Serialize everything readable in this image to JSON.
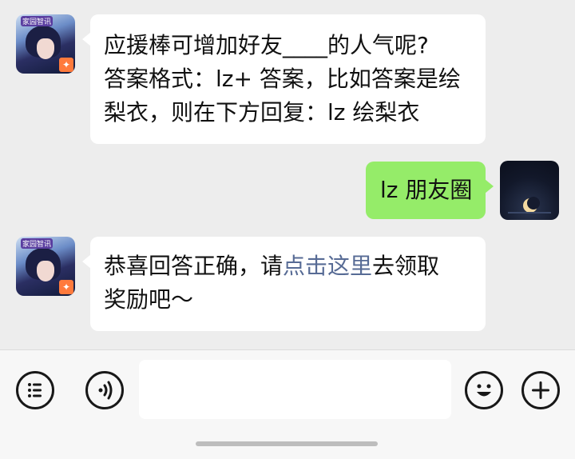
{
  "messages": [
    {
      "sender": "bot",
      "avatar_tag": "家园智讯",
      "lines": [
        "应援棒可增加好友____的人气呢?",
        "答案格式：lz+ 答案，比如答案是绘",
        "梨衣，则在下方回复：lz 绘梨衣"
      ]
    },
    {
      "sender": "user",
      "text": "lz 朋友圈"
    },
    {
      "sender": "bot",
      "avatar_tag": "家园智讯",
      "line1_prefix": "恭喜回答正确，请",
      "line1_link": "点击这里",
      "line1_suffix": "去领取",
      "line2": "奖励吧～"
    }
  ],
  "input_bar": {
    "menu_icon": "list-menu-icon",
    "voice_icon": "voice-icon",
    "emoji_icon": "emoji-icon",
    "plus_icon": "plus-icon",
    "message_value": ""
  },
  "colors": {
    "background": "#ededed",
    "incoming_bubble": "#ffffff",
    "outgoing_bubble": "#95ec69",
    "link": "#576b95"
  }
}
